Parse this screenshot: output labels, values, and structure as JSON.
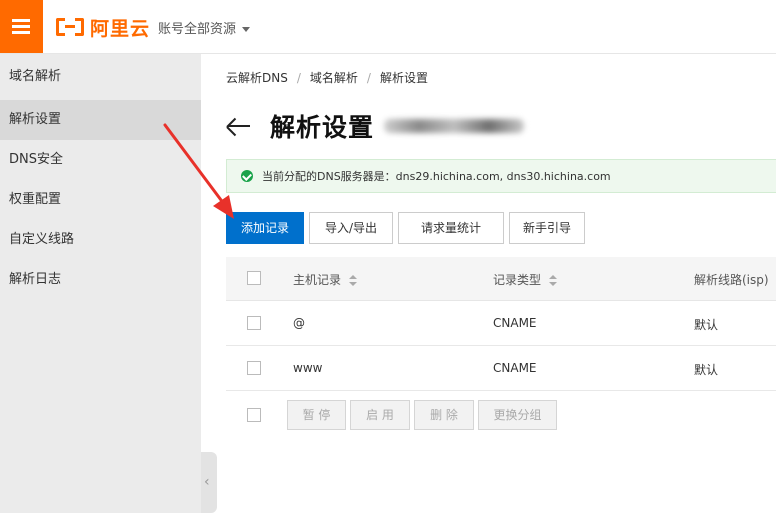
{
  "header": {
    "logo_text": "阿里云",
    "account_label": "账号全部资源"
  },
  "sidebar": {
    "items": [
      {
        "label": "域名解析"
      },
      {
        "label": "解析设置"
      },
      {
        "label": "DNS安全"
      },
      {
        "label": "权重配置"
      },
      {
        "label": "自定义线路"
      },
      {
        "label": "解析日志"
      }
    ],
    "active_index": 1,
    "collapse_glyph": "‹"
  },
  "breadcrumb": [
    "云解析DNS",
    "域名解析",
    "解析设置"
  ],
  "page": {
    "title": "解析设置"
  },
  "notice": {
    "text": "当前分配的DNS服务器是：dns29.hichina.com, dns30.hichina.com"
  },
  "toolbar": {
    "add_record": "添加记录",
    "import_export": "导入/导出",
    "request_stats": "请求量统计",
    "guide": "新手引导"
  },
  "table": {
    "columns": [
      "主机记录",
      "记录类型",
      "解析线路(isp)"
    ],
    "rows": [
      {
        "host": "@",
        "type": "CNAME",
        "line": "默认"
      },
      {
        "host": "www",
        "type": "CNAME",
        "line": "默认"
      }
    ],
    "batch_actions": [
      "暂 停",
      "启 用",
      "删 除",
      "更换分组"
    ]
  },
  "colors": {
    "brand": "#ff6a00",
    "primary_button": "#0070cc",
    "success": "#1aa34a",
    "annotation_arrow": "#e8312a"
  }
}
